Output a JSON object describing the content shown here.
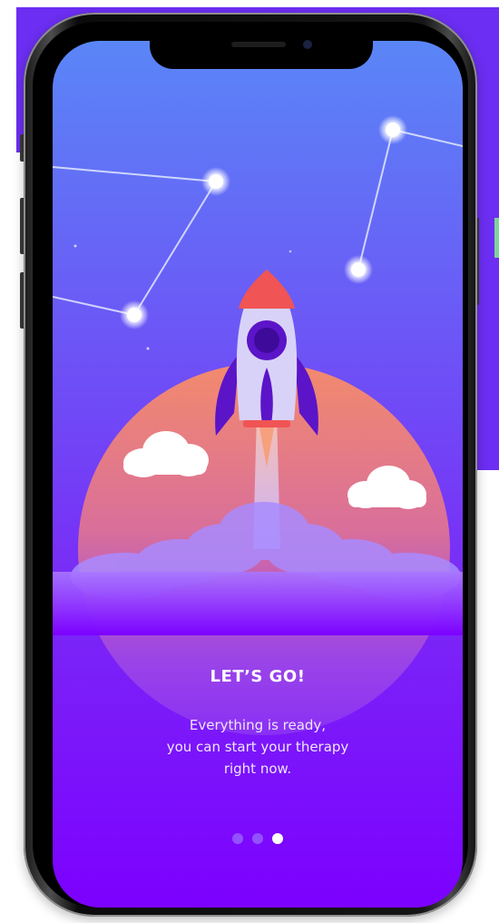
{
  "onboarding": {
    "title": "LET’S GO!",
    "lines": [
      "Everything is ready,",
      "you can start your therapy",
      "right now."
    ],
    "pager": {
      "total": 3,
      "active_index": 2
    }
  },
  "icons": {
    "hero": "rocket-launch-illustration",
    "stars": "constellation-icon",
    "clouds": "cloud-icon"
  },
  "colors": {
    "accent": "#7c00ff",
    "sky_top": "#5a86f7",
    "planet": "#f08a6a",
    "rocket_tip": "#f05454",
    "rocket_body": "#d9d2f8",
    "rocket_fins": "#5b14c8"
  }
}
